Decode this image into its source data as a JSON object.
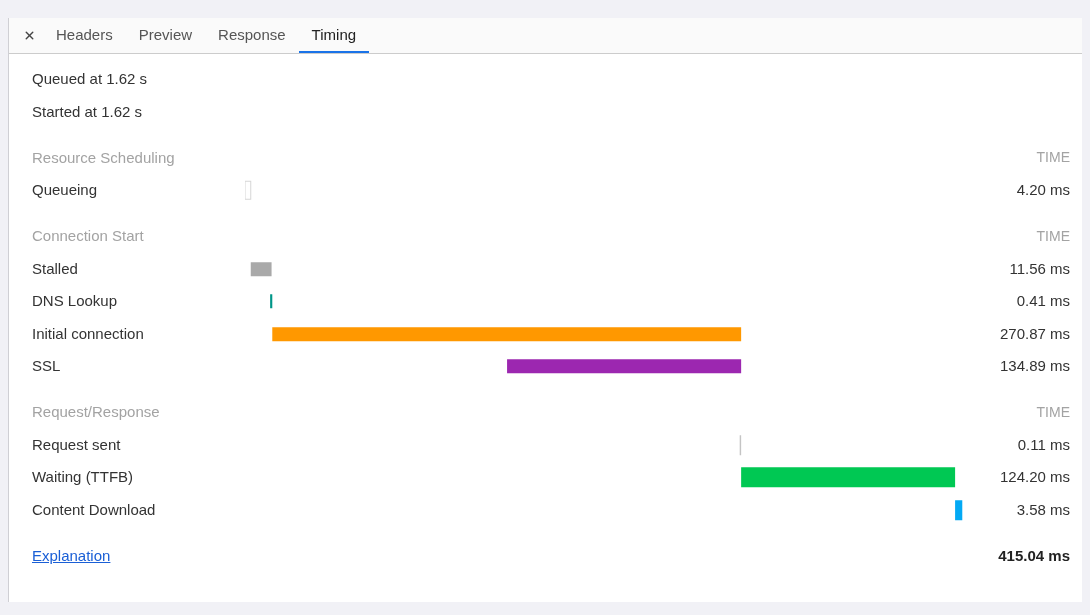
{
  "tabs": [
    {
      "label": "Headers",
      "selected": false
    },
    {
      "label": "Preview",
      "selected": false
    },
    {
      "label": "Response",
      "selected": false
    },
    {
      "label": "Timing",
      "selected": true
    }
  ],
  "summary": [
    "Queued at 1.62 s",
    "Started at 1.62 s"
  ],
  "sections": [
    {
      "title": "Resource Scheduling",
      "column_heading": "TIME",
      "rows": [
        {
          "label": "Queueing",
          "kind": "outline",
          "color": "#d6d6d6",
          "time": "4.20 ms"
        }
      ]
    },
    {
      "title": "Connection Start",
      "column_heading": "TIME",
      "rows": [
        {
          "label": "Stalled",
          "kind": "solid",
          "color": "#a9a9a9",
          "time": "11.56 ms"
        },
        {
          "label": "DNS Lookup",
          "kind": "solid",
          "color": "#009688",
          "time": "0.41 ms"
        },
        {
          "label": "Initial connection",
          "kind": "solid",
          "color": "#ff9800",
          "time": "270.87 ms"
        },
        {
          "label": "SSL",
          "kind": "solid",
          "color": "#9c27b0",
          "time": "134.89 ms"
        }
      ]
    },
    {
      "title": "Request/Response",
      "column_heading": "TIME",
      "rows": [
        {
          "label": "Request sent",
          "kind": "solid",
          "color": "#c4c4c4",
          "time": "0.11 ms"
        },
        {
          "label": "Waiting (TTFB)",
          "kind": "solid",
          "color": "#00c853",
          "time": "124.20 ms"
        },
        {
          "label": "Content Download",
          "kind": "solid",
          "color": "#03a9f4",
          "time": "3.58 ms"
        }
      ]
    }
  ],
  "footer": {
    "link": "Explanation",
    "total": "415.04 ms"
  }
}
